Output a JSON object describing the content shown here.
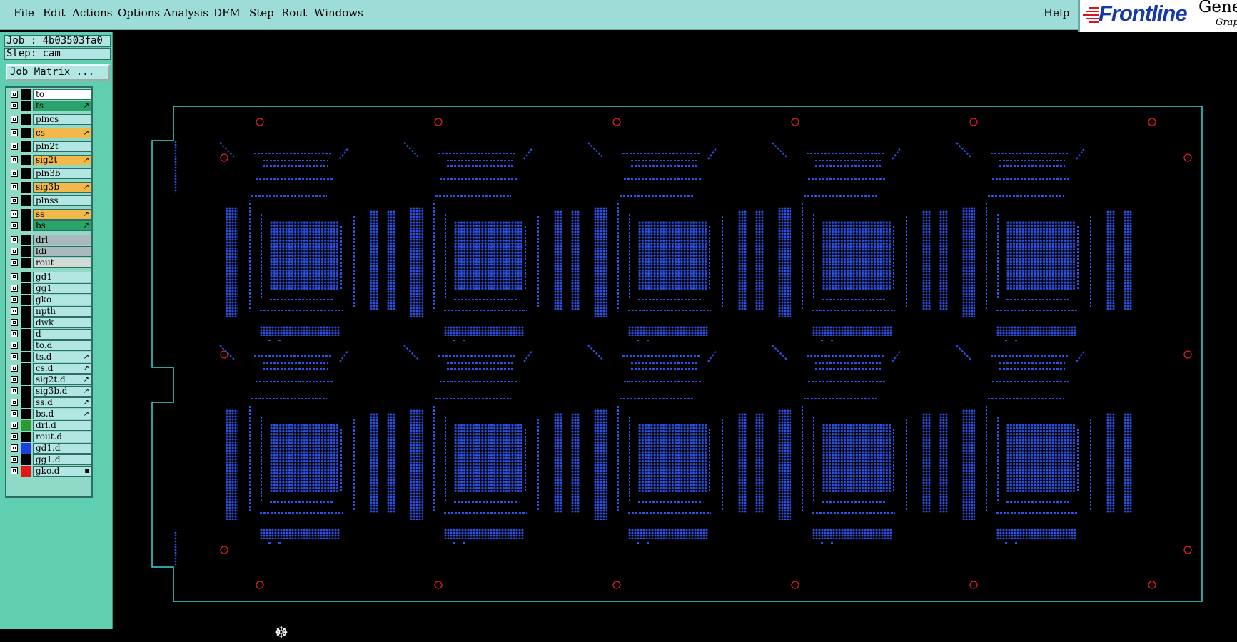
{
  "menu": {
    "file": "File",
    "edit": "Edit",
    "actions": "Actions",
    "options": "Options",
    "analysis": "Analysis",
    "dfm": "DFM",
    "step": "Step",
    "rout": "Rout",
    "windows": "Windows",
    "help": "Help"
  },
  "logo": {
    "brand": "Frontline",
    "product": "Gene",
    "subtitle": "Grap"
  },
  "job": {
    "job_line": "Job : 4b03503fa0",
    "step_line": "Step: cam",
    "matrix_button": "Job Matrix ..."
  },
  "layers": [
    {
      "name": "to",
      "color": "#ffffff",
      "mark": ""
    },
    {
      "name": "ts",
      "color": "#2aa36b",
      "mark": "↗"
    },
    {
      "name": "plncs",
      "color": "#b2e6e2",
      "mark": ""
    },
    {
      "name": "cs",
      "color": "#f2b84a",
      "mark": "↗"
    },
    {
      "name": "pln2t",
      "color": "#b2e6e2",
      "mark": ""
    },
    {
      "name": "sig2t",
      "color": "#f2b84a",
      "mark": "↗"
    },
    {
      "name": "pln3b",
      "color": "#b2e6e2",
      "mark": ""
    },
    {
      "name": "sig3b",
      "color": "#f2b84a",
      "mark": "↗"
    },
    {
      "name": "plnss",
      "color": "#b2e6e2",
      "mark": ""
    },
    {
      "name": "ss",
      "color": "#f2b84a",
      "mark": "↗"
    },
    {
      "name": "bs",
      "color": "#2aa36b",
      "mark": "↗"
    },
    {
      "name": "drl",
      "color": "#a9b9bd",
      "mark": ""
    },
    {
      "name": "ldi",
      "color": "#a9b9bd",
      "mark": ""
    },
    {
      "name": "rout",
      "color": "#d2dad8",
      "mark": ""
    },
    {
      "name": "gd1",
      "color": "#b2e6e2",
      "mark": ""
    },
    {
      "name": "gg1",
      "color": "#b2e6e2",
      "mark": ""
    },
    {
      "name": "gko",
      "color": "#b2e6e2",
      "mark": ""
    },
    {
      "name": "npth",
      "color": "#b2e6e2",
      "mark": ""
    },
    {
      "name": "dwk",
      "color": "#b2e6e2",
      "mark": ""
    },
    {
      "name": "d",
      "color": "#b2e6e2",
      "mark": ""
    },
    {
      "name": "to.d",
      "color": "#b2e6e2",
      "mark": ""
    },
    {
      "name": "ts.d",
      "color": "#b2e6e2",
      "mark": "↗"
    },
    {
      "name": "cs.d",
      "color": "#b2e6e2",
      "mark": "↗"
    },
    {
      "name": "sig2t.d",
      "color": "#b2e6e2",
      "mark": "↗"
    },
    {
      "name": "sig3b.d",
      "color": "#b2e6e2",
      "mark": "↗"
    },
    {
      "name": "ss.d",
      "color": "#b2e6e2",
      "mark": "↗"
    },
    {
      "name": "bs.d",
      "color": "#b2e6e2",
      "mark": "↗"
    },
    {
      "name": "drl.d",
      "color": "#b2e6e2",
      "mark": "",
      "swatch": "#2e9a2e"
    },
    {
      "name": "rout.d",
      "color": "#b2e6e2",
      "mark": ""
    },
    {
      "name": "gd1.d",
      "color": "#b2e6e2",
      "mark": "",
      "swatch": "#1d3fe0"
    },
    {
      "name": "gg1.d",
      "color": "#b2e6e2",
      "mark": ""
    },
    {
      "name": "gko.d",
      "color": "#b2e6e2",
      "mark": "▪",
      "swatch": "#e01818"
    }
  ],
  "colors": {
    "board_outline": "#3fd6d6",
    "pads": "#2b53e8",
    "tooling_holes": "#e0201e",
    "menubar": "#9edcd8",
    "panel": "#5fcfb0"
  },
  "canvas": {
    "origin_icon": "origin-crosshair-icon",
    "array_columns": 5,
    "array_rows": 2
  }
}
